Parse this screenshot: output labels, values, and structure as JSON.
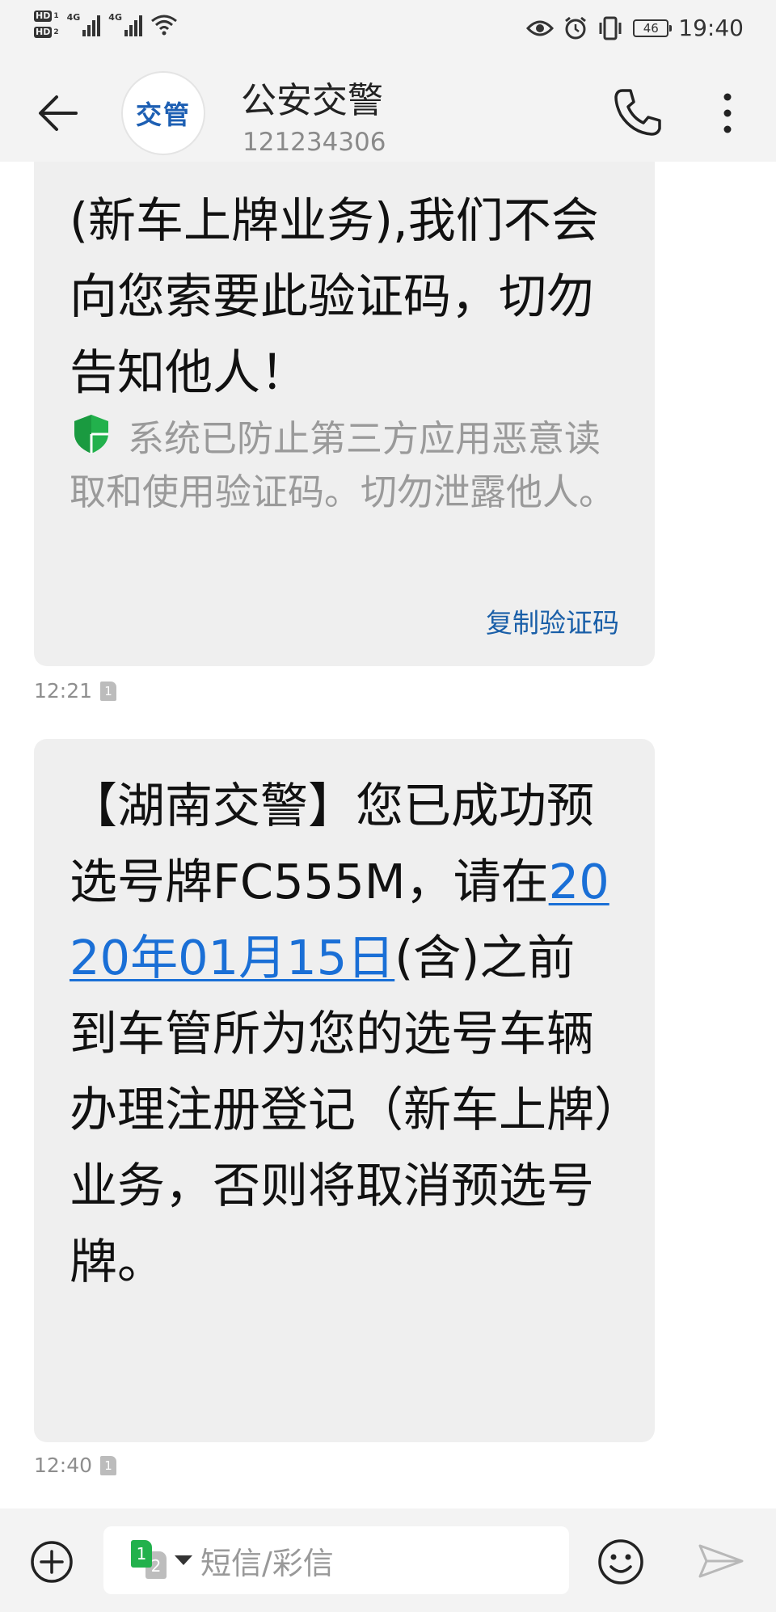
{
  "status_bar": {
    "hd1": "HD",
    "hd1_sub": "1",
    "hd2": "HD",
    "hd2_sub": "2",
    "network1": "4G",
    "network2": "4G",
    "battery": "46",
    "time": "19:40",
    "icons": [
      "eye-comfort-icon",
      "alarm-icon",
      "vibrate-icon",
      "battery-icon",
      "wifi-icon"
    ]
  },
  "header": {
    "avatar_text": "交管",
    "contact_name": "公安交警",
    "contact_number": "121234306",
    "icons": [
      "back-arrow-icon",
      "phone-icon",
      "more-vertical-icon"
    ]
  },
  "messages": [
    {
      "text": "(新车上牌业务),我们不会向您索要此验证码，切勿告知他人！",
      "notice": "系统已防止第三方应用恶意读取和使用验证码。切勿泄露他人。",
      "action": "复制验证码",
      "time": "12:21",
      "sim": "1"
    },
    {
      "text_before": "【湖南交警】您已成功预选号牌FC555M，请在",
      "link": "2020年01月15日",
      "text_after": "(含)之前到车管所为您的选号车辆办理注册登记（新车上牌）业务，否则将取消预选号牌。",
      "time": "12:40",
      "sim": "1"
    }
  ],
  "input_bar": {
    "sim_primary": "1",
    "sim_secondary": "2",
    "placeholder": "短信/彩信",
    "icons": [
      "add-circle-icon",
      "emoji-icon",
      "send-icon"
    ]
  },
  "colors": {
    "bar_bg": "#f3f3f3",
    "bubble_bg": "#efefef",
    "link": "#1a6fd6",
    "action": "#1a5fa8",
    "shield": "#22b14c",
    "sim_green": "#22b14c"
  }
}
